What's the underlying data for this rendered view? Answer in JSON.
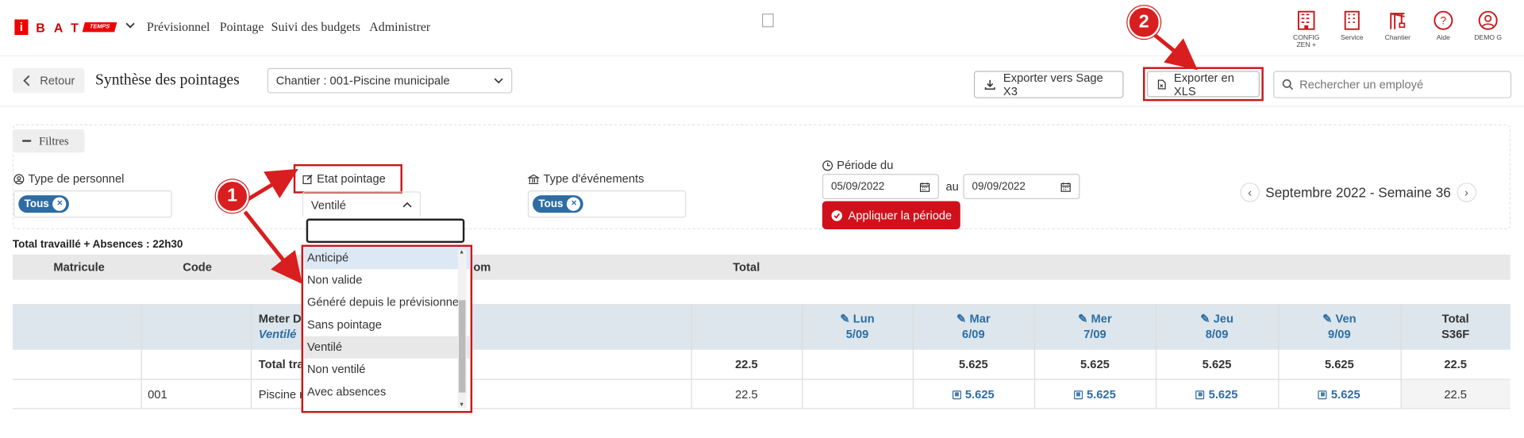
{
  "nav": {
    "logo_i": "i",
    "logo_bat": "BAT",
    "logo_temps": "TEMPS",
    "items": [
      "Prévisionnel",
      "Pointage",
      "Suivi des budgets",
      "Administrer"
    ]
  },
  "top_icons": [
    {
      "label": "CONFIG ZEN +",
      "icon": "building-icon"
    },
    {
      "label": "Service",
      "icon": "building-icon"
    },
    {
      "label": "Chantier",
      "icon": "crane-icon"
    },
    {
      "label": "Aide",
      "icon": "help-icon"
    },
    {
      "label": "DEMO G",
      "icon": "user-icon"
    }
  ],
  "toolbar": {
    "retour": "Retour",
    "title": "Synthèse des pointages",
    "chantier": "Chantier : 001-Piscine municipale",
    "export_sage": "Exporter vers Sage X3",
    "export_xls": "Exporter en XLS",
    "search_placeholder": "Rechercher un employé"
  },
  "filters": {
    "toggle": "Filtres",
    "type_personnel": "Type de personnel",
    "etat_pointage": "Etat pointage",
    "type_evenements": "Type d'événements",
    "periode_du": "Période du",
    "tag": "Tous",
    "etat_selected": "Ventilé",
    "date_from": "05/09/2022",
    "au": "au",
    "date_to": "09/09/2022",
    "apply": "Appliquer la période",
    "week": "Septembre 2022 - Semaine 36"
  },
  "dropdown": {
    "options": [
      "Anticipé",
      "Non valide",
      "Généré depuis le prévisionnel",
      "Sans pointage",
      "Ventilé",
      "Non ventilé",
      "Avec absences"
    ],
    "highlighted": "Anticipé",
    "selected": "Ventilé"
  },
  "summary": "Total travaillé + Absences : 22h30",
  "table": {
    "headers": {
      "matricule": "Matricule",
      "code": "Code",
      "nom": "om",
      "total": "Total"
    },
    "employee": {
      "name": "Meter De",
      "status": "Ventilé"
    },
    "days": [
      {
        "day": "Lun",
        "date": "5/09"
      },
      {
        "day": "Mar",
        "date": "6/09"
      },
      {
        "day": "Mer",
        "date": "7/09"
      },
      {
        "day": "Jeu",
        "date": "8/09"
      },
      {
        "day": "Ven",
        "date": "9/09"
      }
    ],
    "total_col": {
      "label": "Total",
      "sub": "S36F"
    },
    "total_row": {
      "label": "Total tra",
      "total": "22.5",
      "days": [
        "",
        "5.625",
        "5.625",
        "5.625",
        "5.625"
      ],
      "week_total": "22.5"
    },
    "detail_row": {
      "code": "001",
      "name": "Piscine r",
      "total": "22.5",
      "days": [
        "",
        "5.625",
        "5.625",
        "5.625",
        "5.625"
      ],
      "week_total": "22.5"
    }
  },
  "annotations": {
    "badge1": "1",
    "badge2": "2"
  },
  "colors": {
    "brand_red": "#d0101b",
    "tag_blue": "#2e6da4",
    "annotation_red": "#c9181b"
  }
}
